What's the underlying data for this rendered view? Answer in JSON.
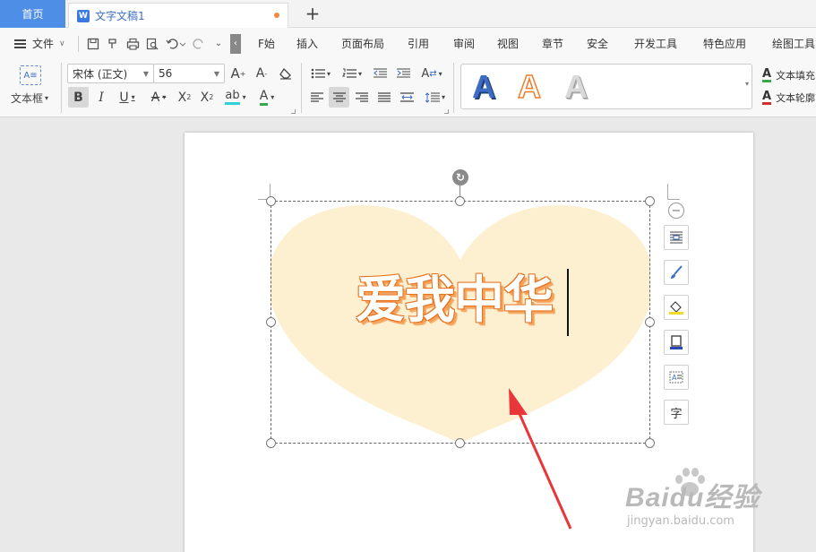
{
  "tabs": {
    "home": "首页",
    "doc_badge": "W",
    "doc_title": "文字文稿1",
    "add_tab": "+"
  },
  "menu": {
    "file": "文件",
    "start_partial": "F始",
    "items": [
      "插入",
      "页面布局",
      "引用",
      "审阅",
      "视图",
      "章节",
      "安全",
      "开发工具",
      "特色应用",
      "绘图工具"
    ]
  },
  "ribbon": {
    "textbox_label": "文本框",
    "font_name": "宋体 (正文)",
    "font_size": "56",
    "style_letter": "A",
    "text_fill": "文本填充",
    "text_outline": "文本轮廓"
  },
  "document": {
    "wordart_text": "爱我中华",
    "heart_color": "#fdf0d0",
    "wordart_outline_color": "#e5721f"
  },
  "side_tools": {
    "char_icon": "字"
  },
  "watermark": {
    "main": "Baidu经验",
    "sub": "jingyan.baidu.com"
  },
  "colors": {
    "accent": "#4f8ee6",
    "arrow": "#e8363a"
  }
}
